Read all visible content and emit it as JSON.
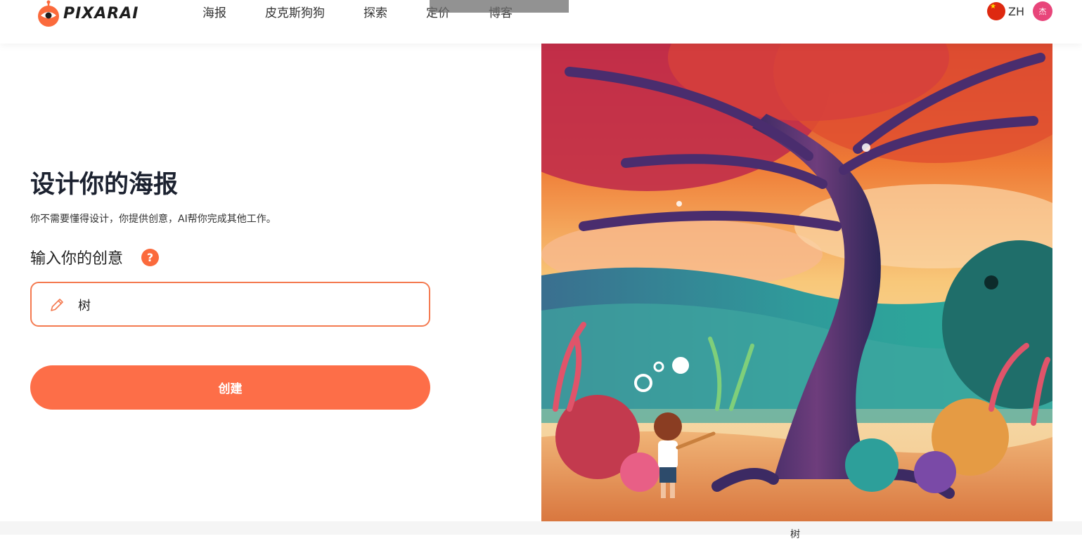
{
  "header": {
    "logo_text": "PIXARAI",
    "nav": [
      "海报",
      "皮克斯狗狗",
      "探索",
      "定价",
      "博客"
    ],
    "language": "ZH",
    "avatar_text": "杰"
  },
  "main": {
    "title": "设计你的海报",
    "subtitle": "你不需要懂得设计，你提供创意，AI帮你完成其他工作。",
    "idea_label": "输入你的创意",
    "help_glyph": "?",
    "idea_value": "树",
    "create_label": "创建"
  },
  "footer": {
    "caption": "树"
  },
  "colors": {
    "accent": "#fd6e48",
    "input_border": "#f47a50",
    "avatar": "#e8457a",
    "flag": "#de2910"
  }
}
